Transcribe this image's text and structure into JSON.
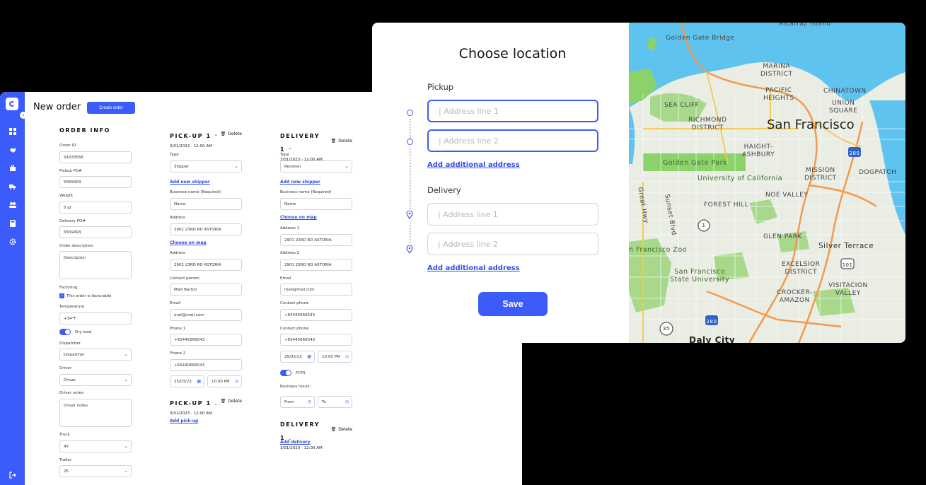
{
  "app": {
    "page_title": "New order",
    "create_button": "Create order",
    "sidebar_toggle": "›"
  },
  "order_info": {
    "title": "ORDER INFO",
    "order_id_label": "Order ID",
    "order_id": "54333556",
    "pickup_po_label": "Pickup PO#",
    "pickup_po": "5569493",
    "weight_label": "Weight",
    "weight": "5 gr",
    "delivery_po_label": "Delivery PO#",
    "delivery_po": "5569493",
    "description_label": "Order description",
    "description": "Description",
    "factoring_label": "Factoring",
    "factorable_text": "This order is factorable",
    "temperature_label": "Temperature",
    "temperature": "+34°F",
    "dry_load_text": "Dry load",
    "dispatcher_label": "Dispatcher",
    "dispatcher": "Dispatcher",
    "driver_label": "Driver",
    "driver": "Driver",
    "driver_notes_label": "Driver notes",
    "driver_notes": "Driver notes",
    "truck_label": "Truck",
    "truck": "45",
    "trailer_label": "Trailer",
    "trailer": "25"
  },
  "pickup": {
    "title": "PICK-UP 1",
    "delete": "Delete",
    "date": "3/01/2023 - 12:00 AM",
    "type_label": "Type",
    "type": "Shipper",
    "add_shipper": "Add new shipper",
    "business_label": "Business name (Required)",
    "business": "Name",
    "address_label": "Address",
    "address": "2901 23RD RD ASTORIA",
    "choose_map": "Choose on map",
    "address2_label": "Address",
    "address2": "2901 23RD RD ASTORIA",
    "contact_label": "Contact person",
    "contact": "Matt Barton",
    "email_label": "Email",
    "email": "mail@mail.com",
    "phone1_label": "Phone 1",
    "phone1": "+65445666543",
    "phone2_label": "Phone 2",
    "phone2": "+65440666543",
    "date_field": "25/03/23",
    "time_field": "10:00 PM",
    "second_title": "PICK-UP 1",
    "second_date": "3/01/2023 - 12:00 AM",
    "add_pickup": "Add pick-up"
  },
  "delivery": {
    "title": "DELIVERY 1",
    "delete": "Delete",
    "date": "3/01/2023 - 12:00 AM",
    "type_label": "Type",
    "type": "Receiver",
    "add_shipper": "Add new shipper",
    "business_label": "Business name (Required)",
    "business": "Name",
    "choose_map": "Choose on map",
    "address1_label": "Address 1",
    "address1": "2901 23RD RD ASTORIA",
    "address2_label": "Address 2",
    "address2": "2901 23RD RD ASTORIA",
    "email_label": "Email",
    "email": "mail@mail.com",
    "phone1_label": "Contact phone",
    "phone1": "+65445666543",
    "phone2_label": "Contact phone",
    "phone2": "+65445666543",
    "date_field": "25/03/23",
    "time_field": "10:00 PM",
    "fcfs_text": "FCFS",
    "business_hours_label": "Business hours:",
    "from": "From",
    "to": "To",
    "second_title": "DELIVERY 1",
    "second_date": "3/01/2023 - 12:00 AM",
    "add_delivery": "Add delivery"
  },
  "modal": {
    "title": "Choose location",
    "pickup_label": "Pickup",
    "pickup_line1_placeholder": "| Address line 1",
    "pickup_line2_placeholder": "| Address line 2",
    "add_address": "Add additional address",
    "delivery_label": "Delivery",
    "delivery_line1_placeholder": "| Address line 1",
    "delivery_line2_placeholder": "| Address line 2",
    "add_address_2": "Add additional address",
    "save": "Save"
  },
  "map": {
    "labels": {
      "golden_gate_bridge": "Golden Gate Bridge",
      "alcatraz": "Alcatraz Island",
      "marina": "MARINA\nDISTRICT",
      "pacific_heights": "PACIFIC\nHEIGHTS",
      "chinatown": "CHINATOWN",
      "union_square": "UNION\nSQUARE",
      "sea_cliff": "SEA CLIFF",
      "richmond": "RICHMOND\nDISTRICT",
      "san_francisco": "San Francisco",
      "haight": "HAIGHT-\nASHBURY",
      "golden_gate_park": "Golden Gate Park",
      "ucsf": "University of California",
      "mission": "MISSION\nDISTRICT",
      "dogpatch": "DOGPATCH",
      "noe": "NOE VALLEY",
      "forest_hill": "FOREST HILL",
      "great_hwy": "Great Hwy",
      "sunset": "Sunset Blvd",
      "glen_park": "GLEN PARK",
      "zoo": "n Francisco Zoo",
      "silver_terrace": "Silver Terrace",
      "excelsior": "EXCELSIOR\nDISTRICT",
      "sfsu": "San Francisco\nState University",
      "crocker": "CROCKER-\nAMAZON",
      "visitacion": "VISITACION\nVALLEY",
      "daly": "Daly City",
      "hw280a": "280",
      "hw280b": "280",
      "hw101": "101",
      "hw1": "1",
      "hw35": "35"
    }
  }
}
